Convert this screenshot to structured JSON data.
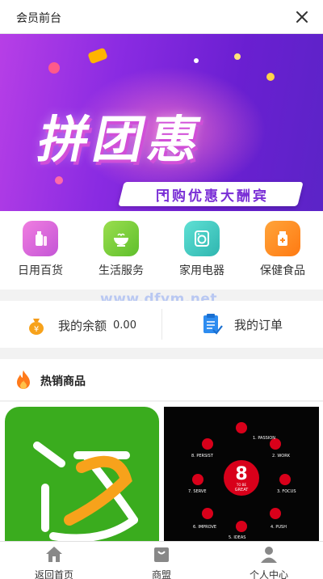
{
  "header": {
    "title": "会员前台"
  },
  "banner": {
    "headline": "拼团惠",
    "subline": "团购优惠大酬宾"
  },
  "categories": [
    {
      "label": "日用百货",
      "icon": "bottle-icon",
      "color": "#e36ad0"
    },
    {
      "label": "生活服务",
      "icon": "bowl-icon",
      "color": "#7ccf3a"
    },
    {
      "label": "家用电器",
      "icon": "washing-machine-icon",
      "color": "#3cc9c0"
    },
    {
      "label": "保健食品",
      "icon": "medicine-icon",
      "color": "#ff8a1f"
    }
  ],
  "account": {
    "balance_label": "我的余额",
    "balance_value": "0.00",
    "orders_label": "我的订单"
  },
  "watermark": "www.dfym.net",
  "hot": {
    "title": "热销商品"
  },
  "products": [
    {
      "icon": "fanli-logo-icon"
    },
    {
      "icon": "eight-to-great-poster-icon",
      "center_number": "8",
      "center_text1": "TO BE",
      "center_text2": "GREAT",
      "labels": [
        "1. PASSION",
        "2. WORK",
        "3. FOCUS",
        "4. PUSH",
        "5. IDEAS",
        "6. IMPROVE",
        "7. SERVE",
        "8. PERSIST"
      ]
    }
  ],
  "tabbar": [
    {
      "label": "返回首页",
      "icon": "home-icon"
    },
    {
      "label": "商盟",
      "icon": "shop-bag-icon"
    },
    {
      "label": "个人中心",
      "icon": "user-icon"
    }
  ]
}
